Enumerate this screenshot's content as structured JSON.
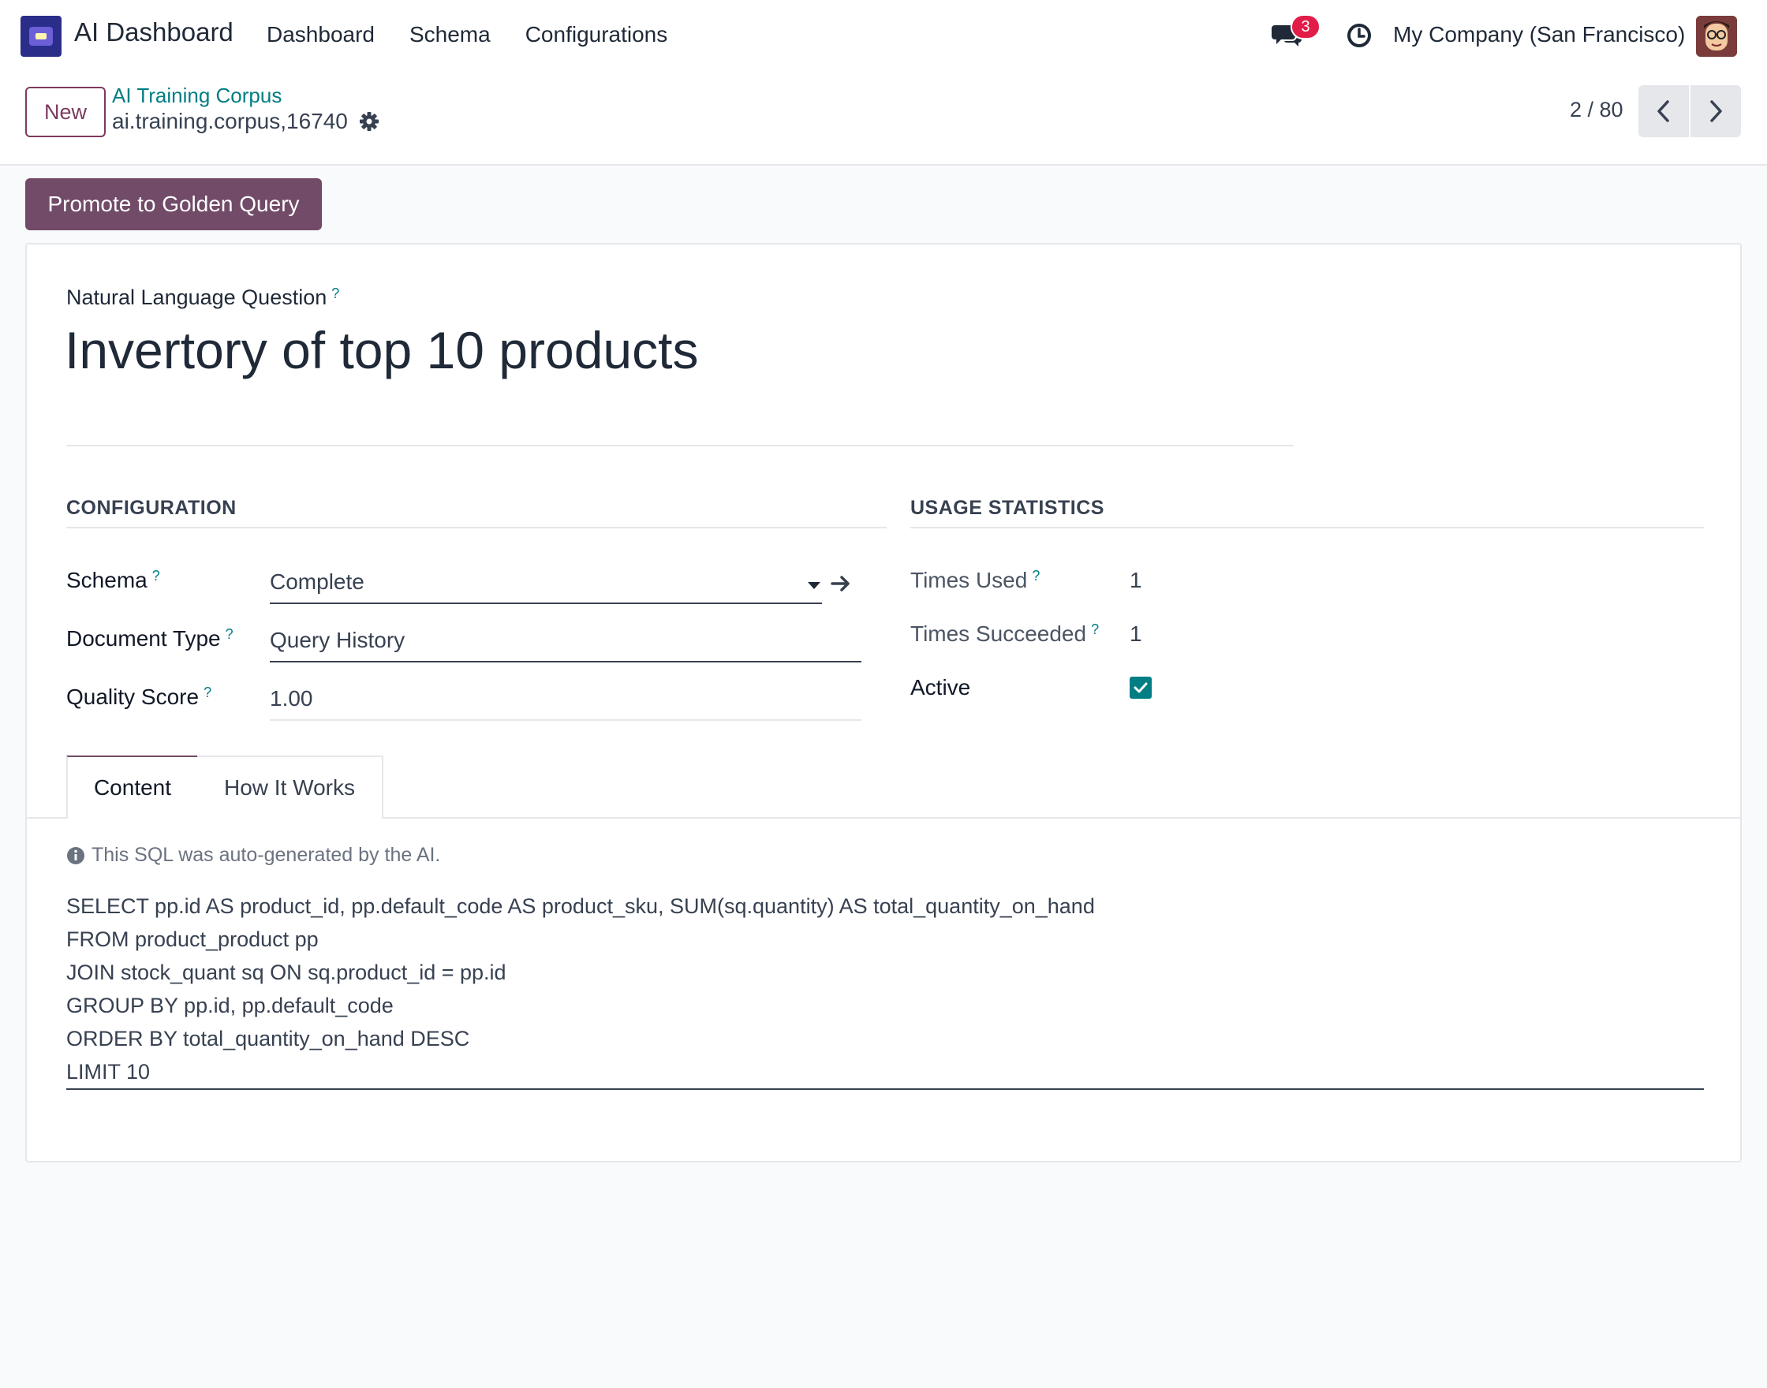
{
  "navbar": {
    "app_name": "AI Dashboard",
    "menu": [
      "Dashboard",
      "Schema",
      "Configurations"
    ],
    "message_count": "3",
    "company": "My Company (San Francisco)"
  },
  "control": {
    "new_label": "New",
    "breadcrumb": "AI Training Corpus",
    "record_name": "ai.training.corpus,16740",
    "pager": "2 / 80"
  },
  "actions": {
    "promote_label": "Promote to Golden Query"
  },
  "form": {
    "question_label": "Natural Language Question",
    "question": "Invertory of top 10 products",
    "help_mark": "?",
    "configuration": {
      "title": "CONFIGURATION",
      "schema_label": "Schema",
      "schema_value": "Complete",
      "doc_type_label": "Document Type",
      "doc_type_value": "Query History",
      "quality_label": "Quality Score",
      "quality_value": "1.00"
    },
    "usage": {
      "title": "USAGE STATISTICS",
      "times_used_label": "Times Used",
      "times_used_value": "1",
      "times_succeeded_label": "Times Succeeded",
      "times_succeeded_value": "1",
      "active_label": "Active",
      "active": true
    },
    "tabs": [
      "Content",
      "How It Works"
    ],
    "content": {
      "info": "This SQL was auto-generated by the AI.",
      "sql_lines": [
        "SELECT pp.id AS product_id, pp.default_code AS product_sku, SUM(sq.quantity) AS total_quantity_on_hand",
        "FROM product_product pp",
        "JOIN stock_quant sq ON sq.product_id = pp.id",
        "GROUP BY pp.id, pp.default_code",
        "ORDER BY total_quantity_on_hand DESC",
        "LIMIT 10"
      ]
    }
  },
  "colors": {
    "brand": "#714b67",
    "accent": "#017e84",
    "badge": "#e11d48"
  }
}
